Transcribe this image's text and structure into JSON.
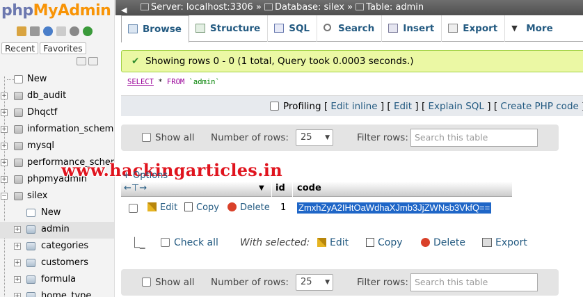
{
  "logo": {
    "php": "php",
    "my": "My",
    "admin": "Admin"
  },
  "sidebar": {
    "tabs": [
      "Recent",
      "Favorites"
    ],
    "databases": [
      {
        "label": "New",
        "type": "new"
      },
      {
        "label": "db_audit"
      },
      {
        "label": "Dhqctf"
      },
      {
        "label": "information_schema"
      },
      {
        "label": "mysql"
      },
      {
        "label": "performance_schema"
      },
      {
        "label": "phpmyadmin"
      },
      {
        "label": "silex",
        "expanded": true
      }
    ],
    "silex_tables": [
      "New",
      "admin",
      "categories",
      "customers",
      "formula",
      "home_type"
    ]
  },
  "breadcrumb": {
    "server": "Server: localhost:3306",
    "database": "Database: silex",
    "table": "Table: admin"
  },
  "tabs": [
    "Browse",
    "Structure",
    "SQL",
    "Search",
    "Insert",
    "Export",
    "More"
  ],
  "message": "Showing rows 0 - 0 (1 total, Query took 0.0003 seconds.)",
  "query": {
    "select": "SELECT",
    "star": "*",
    "from": "FROM",
    "table": "`admin`"
  },
  "profiling": {
    "label": "Profiling",
    "links": [
      "Edit inline",
      "Edit",
      "Explain SQL",
      "Create PHP code"
    ]
  },
  "nav": {
    "show_all": "Show all",
    "num_rows_label": "Number of rows:",
    "num_rows": "25",
    "filter_label": "Filter rows:",
    "filter_placeholder": "Search this table"
  },
  "watermark": "www.hackingarticles.in",
  "options_label": "+ Options",
  "table": {
    "columns": [
      "id",
      "code"
    ],
    "row": {
      "edit": "Edit",
      "copy": "Copy",
      "delete": "Delete",
      "id": "1",
      "code": "ZmxhZyA2IHtOaWdhaXJmb3JjZWNsb3VkfQ=="
    }
  },
  "with_selected": {
    "check_all": "Check all",
    "label": "With selected:",
    "edit": "Edit",
    "copy": "Copy",
    "delete": "Delete",
    "export": "Export"
  }
}
